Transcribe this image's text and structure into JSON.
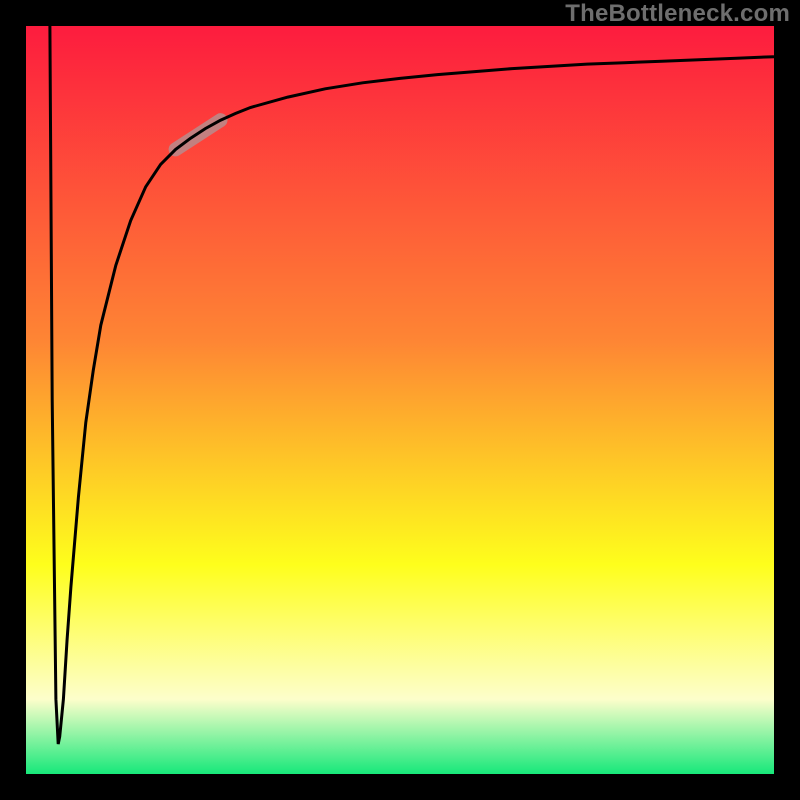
{
  "watermark": "TheBottleneck.com",
  "colors": {
    "gradient_top": "#fd1c3e",
    "gradient_mid1": "#fe8534",
    "gradient_mid2": "#fefe1c",
    "gradient_mid3": "#fdfecb",
    "gradient_bottom": "#17e87a",
    "frame": "#000000",
    "curve": "#000000",
    "highlight": "#c28080"
  },
  "chart_data": {
    "type": "line",
    "title": "",
    "xlabel": "",
    "ylabel": "",
    "xlim": [
      0,
      100
    ],
    "ylim": [
      0,
      100
    ],
    "x": [
      3.2,
      3.5,
      4.0,
      4.3,
      4.5,
      5.0,
      5.5,
      6.0,
      7.0,
      8.0,
      9.0,
      10,
      12,
      14,
      16,
      18,
      20,
      22,
      24,
      26,
      28,
      30,
      35,
      40,
      45,
      50,
      55,
      60,
      65,
      70,
      75,
      80,
      85,
      90,
      95,
      100
    ],
    "y": [
      100,
      50,
      10,
      4,
      5,
      10,
      18,
      25,
      37,
      47,
      54,
      60,
      68,
      74,
      78.5,
      81.5,
      83.5,
      85,
      86.3,
      87.4,
      88.3,
      89.1,
      90.5,
      91.6,
      92.4,
      93.0,
      93.5,
      93.9,
      94.3,
      94.6,
      94.9,
      95.1,
      95.3,
      95.5,
      95.7,
      95.9
    ],
    "highlight_segment": {
      "x_start": 20,
      "x_end": 26,
      "y_start": 83.5,
      "y_end": 87.4
    },
    "legend": [],
    "annotations": []
  }
}
